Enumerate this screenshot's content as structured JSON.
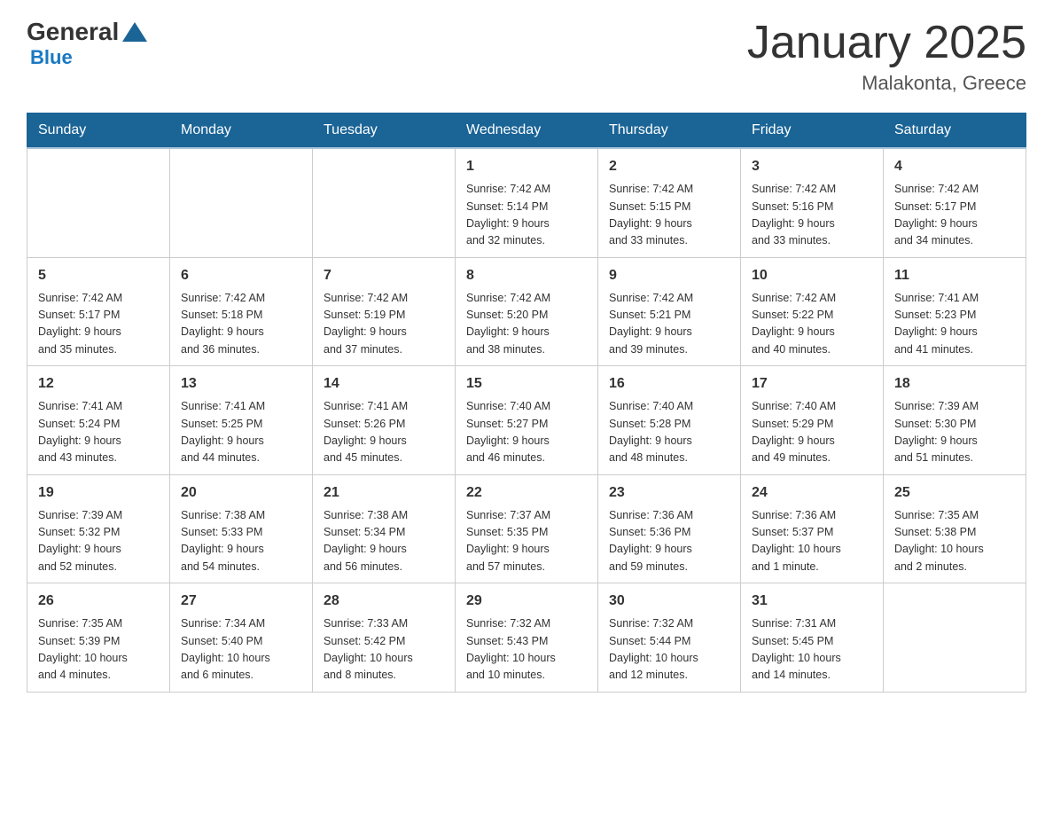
{
  "logo": {
    "text_general": "General",
    "text_blue": "Blue"
  },
  "header": {
    "title": "January 2025",
    "subtitle": "Malakonta, Greece"
  },
  "weekdays": [
    "Sunday",
    "Monday",
    "Tuesday",
    "Wednesday",
    "Thursday",
    "Friday",
    "Saturday"
  ],
  "weeks": [
    {
      "days": [
        {
          "number": "",
          "info": ""
        },
        {
          "number": "",
          "info": ""
        },
        {
          "number": "",
          "info": ""
        },
        {
          "number": "1",
          "info": "Sunrise: 7:42 AM\nSunset: 5:14 PM\nDaylight: 9 hours\nand 32 minutes."
        },
        {
          "number": "2",
          "info": "Sunrise: 7:42 AM\nSunset: 5:15 PM\nDaylight: 9 hours\nand 33 minutes."
        },
        {
          "number": "3",
          "info": "Sunrise: 7:42 AM\nSunset: 5:16 PM\nDaylight: 9 hours\nand 33 minutes."
        },
        {
          "number": "4",
          "info": "Sunrise: 7:42 AM\nSunset: 5:17 PM\nDaylight: 9 hours\nand 34 minutes."
        }
      ]
    },
    {
      "days": [
        {
          "number": "5",
          "info": "Sunrise: 7:42 AM\nSunset: 5:17 PM\nDaylight: 9 hours\nand 35 minutes."
        },
        {
          "number": "6",
          "info": "Sunrise: 7:42 AM\nSunset: 5:18 PM\nDaylight: 9 hours\nand 36 minutes."
        },
        {
          "number": "7",
          "info": "Sunrise: 7:42 AM\nSunset: 5:19 PM\nDaylight: 9 hours\nand 37 minutes."
        },
        {
          "number": "8",
          "info": "Sunrise: 7:42 AM\nSunset: 5:20 PM\nDaylight: 9 hours\nand 38 minutes."
        },
        {
          "number": "9",
          "info": "Sunrise: 7:42 AM\nSunset: 5:21 PM\nDaylight: 9 hours\nand 39 minutes."
        },
        {
          "number": "10",
          "info": "Sunrise: 7:42 AM\nSunset: 5:22 PM\nDaylight: 9 hours\nand 40 minutes."
        },
        {
          "number": "11",
          "info": "Sunrise: 7:41 AM\nSunset: 5:23 PM\nDaylight: 9 hours\nand 41 minutes."
        }
      ]
    },
    {
      "days": [
        {
          "number": "12",
          "info": "Sunrise: 7:41 AM\nSunset: 5:24 PM\nDaylight: 9 hours\nand 43 minutes."
        },
        {
          "number": "13",
          "info": "Sunrise: 7:41 AM\nSunset: 5:25 PM\nDaylight: 9 hours\nand 44 minutes."
        },
        {
          "number": "14",
          "info": "Sunrise: 7:41 AM\nSunset: 5:26 PM\nDaylight: 9 hours\nand 45 minutes."
        },
        {
          "number": "15",
          "info": "Sunrise: 7:40 AM\nSunset: 5:27 PM\nDaylight: 9 hours\nand 46 minutes."
        },
        {
          "number": "16",
          "info": "Sunrise: 7:40 AM\nSunset: 5:28 PM\nDaylight: 9 hours\nand 48 minutes."
        },
        {
          "number": "17",
          "info": "Sunrise: 7:40 AM\nSunset: 5:29 PM\nDaylight: 9 hours\nand 49 minutes."
        },
        {
          "number": "18",
          "info": "Sunrise: 7:39 AM\nSunset: 5:30 PM\nDaylight: 9 hours\nand 51 minutes."
        }
      ]
    },
    {
      "days": [
        {
          "number": "19",
          "info": "Sunrise: 7:39 AM\nSunset: 5:32 PM\nDaylight: 9 hours\nand 52 minutes."
        },
        {
          "number": "20",
          "info": "Sunrise: 7:38 AM\nSunset: 5:33 PM\nDaylight: 9 hours\nand 54 minutes."
        },
        {
          "number": "21",
          "info": "Sunrise: 7:38 AM\nSunset: 5:34 PM\nDaylight: 9 hours\nand 56 minutes."
        },
        {
          "number": "22",
          "info": "Sunrise: 7:37 AM\nSunset: 5:35 PM\nDaylight: 9 hours\nand 57 minutes."
        },
        {
          "number": "23",
          "info": "Sunrise: 7:36 AM\nSunset: 5:36 PM\nDaylight: 9 hours\nand 59 minutes."
        },
        {
          "number": "24",
          "info": "Sunrise: 7:36 AM\nSunset: 5:37 PM\nDaylight: 10 hours\nand 1 minute."
        },
        {
          "number": "25",
          "info": "Sunrise: 7:35 AM\nSunset: 5:38 PM\nDaylight: 10 hours\nand 2 minutes."
        }
      ]
    },
    {
      "days": [
        {
          "number": "26",
          "info": "Sunrise: 7:35 AM\nSunset: 5:39 PM\nDaylight: 10 hours\nand 4 minutes."
        },
        {
          "number": "27",
          "info": "Sunrise: 7:34 AM\nSunset: 5:40 PM\nDaylight: 10 hours\nand 6 minutes."
        },
        {
          "number": "28",
          "info": "Sunrise: 7:33 AM\nSunset: 5:42 PM\nDaylight: 10 hours\nand 8 minutes."
        },
        {
          "number": "29",
          "info": "Sunrise: 7:32 AM\nSunset: 5:43 PM\nDaylight: 10 hours\nand 10 minutes."
        },
        {
          "number": "30",
          "info": "Sunrise: 7:32 AM\nSunset: 5:44 PM\nDaylight: 10 hours\nand 12 minutes."
        },
        {
          "number": "31",
          "info": "Sunrise: 7:31 AM\nSunset: 5:45 PM\nDaylight: 10 hours\nand 14 minutes."
        },
        {
          "number": "",
          "info": ""
        }
      ]
    }
  ]
}
